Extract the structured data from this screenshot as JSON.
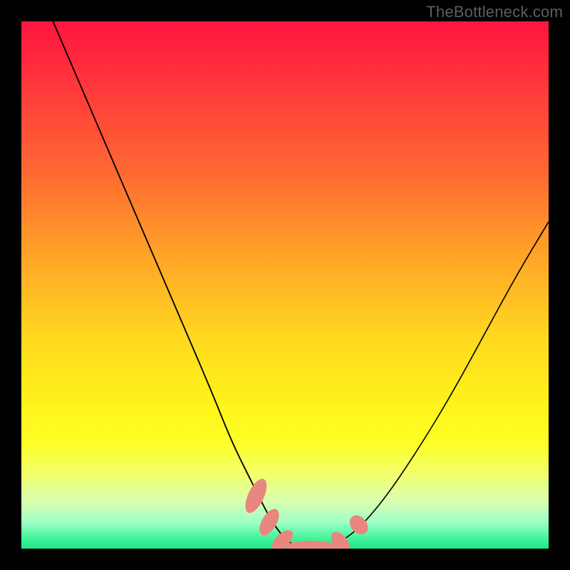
{
  "watermark": "TheBottleneck.com",
  "chart_data": {
    "type": "line",
    "title": "",
    "xlabel": "",
    "ylabel": "",
    "xlim": [
      0,
      100
    ],
    "ylim": [
      0,
      100
    ],
    "series": [
      {
        "name": "left-curve",
        "x": [
          6,
          12,
          18,
          24,
          30,
          36,
          40,
          44,
          47,
          49,
          51,
          53
        ],
        "y": [
          100,
          86,
          72,
          58,
          44,
          30,
          20,
          12,
          6,
          3,
          1,
          0
        ]
      },
      {
        "name": "right-curve",
        "x": [
          58,
          60,
          63,
          66,
          70,
          76,
          82,
          88,
          94,
          100
        ],
        "y": [
          0,
          1,
          3,
          6,
          11,
          20,
          30,
          41,
          52,
          62
        ]
      }
    ],
    "markers": [
      {
        "cx": 44.5,
        "cy": 10,
        "rx": 1.5,
        "ry": 3.5,
        "rot": 25
      },
      {
        "cx": 47.0,
        "cy": 5,
        "rx": 1.4,
        "ry": 2.8,
        "rot": 30
      },
      {
        "cx": 49.5,
        "cy": 1.5,
        "rx": 1.3,
        "ry": 2.5,
        "rot": 45
      },
      {
        "cx": 55.0,
        "cy": 0.3,
        "rx": 5.0,
        "ry": 1.2,
        "rot": 0
      },
      {
        "cx": 60.5,
        "cy": 1.3,
        "rx": 1.3,
        "ry": 2.2,
        "rot": -40
      },
      {
        "cx": 64.0,
        "cy": 4.5,
        "rx": 1.5,
        "ry": 2.0,
        "rot": -40
      }
    ],
    "background_gradient": {
      "top": "#ff153f",
      "mid": "#ffd81f",
      "bottom": "#1de586"
    }
  }
}
